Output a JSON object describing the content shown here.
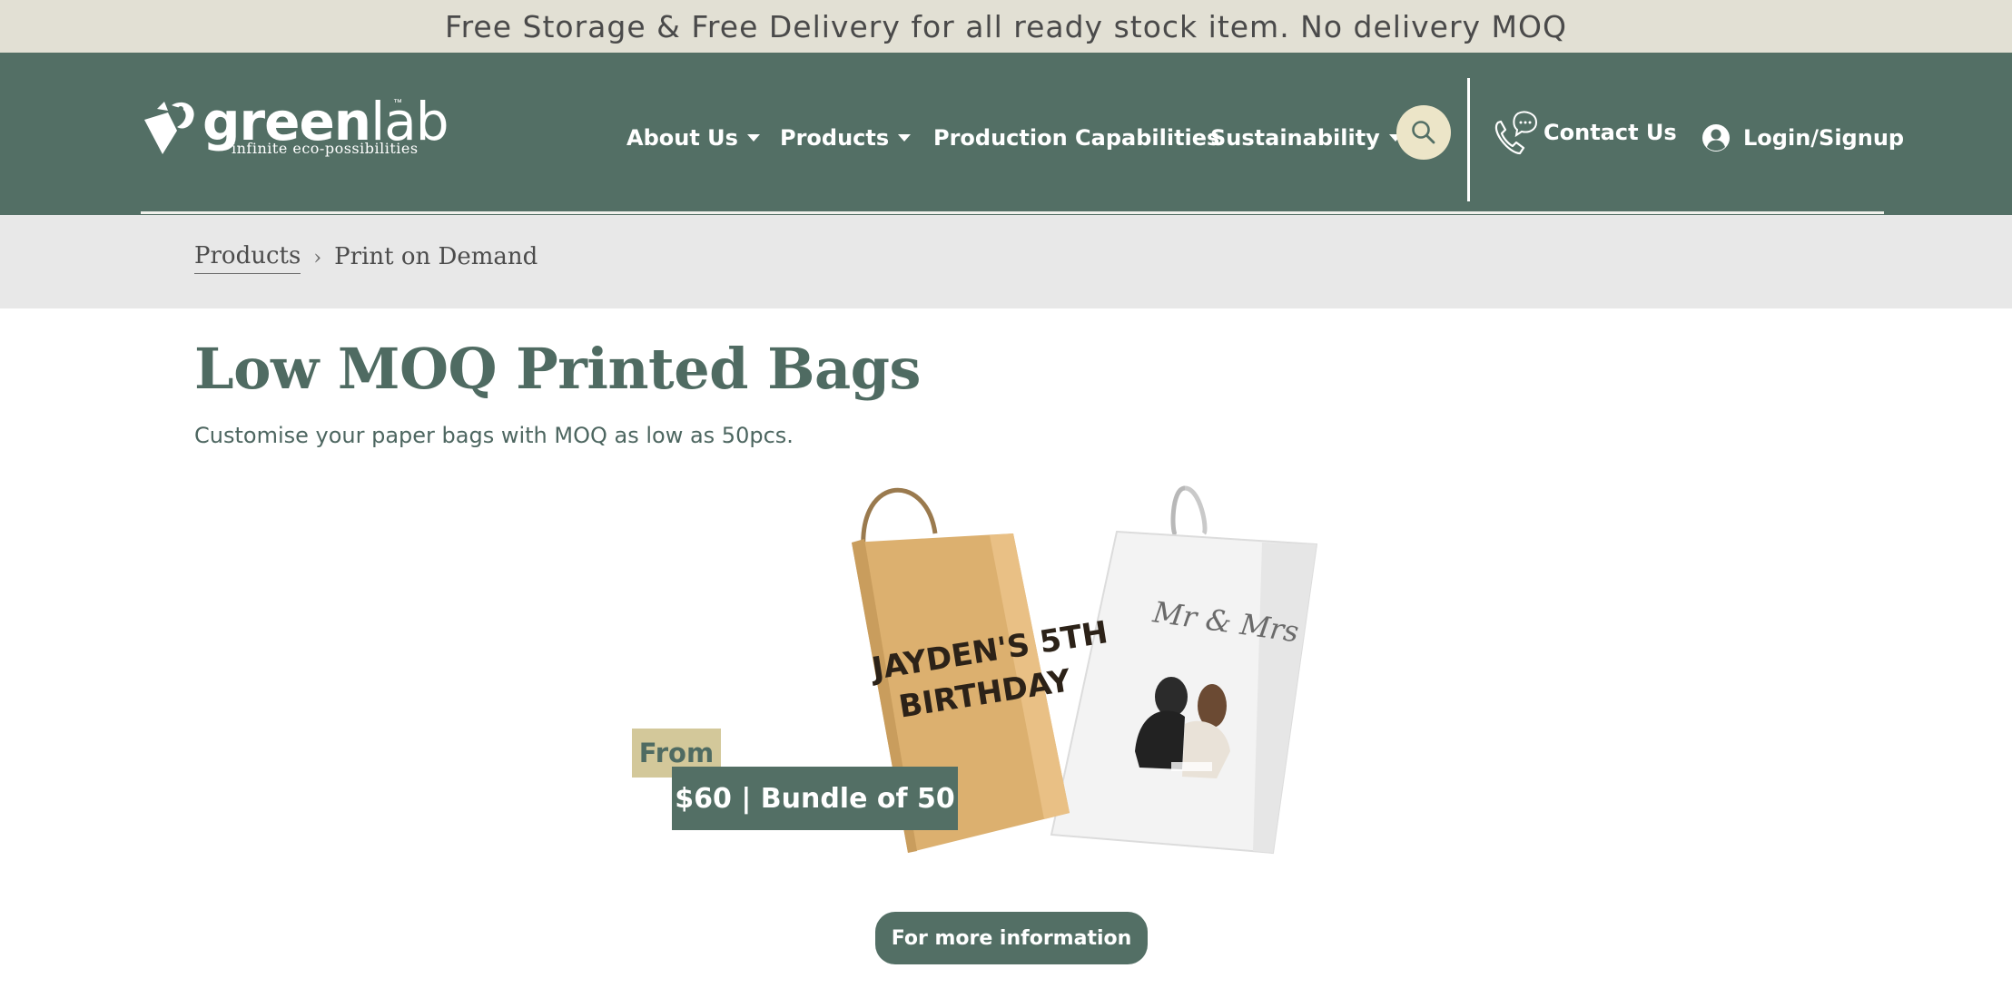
{
  "announcement": {
    "text": "Free Storage & Free Delivery for all ready stock item. No delivery MOQ"
  },
  "logo": {
    "word_bold": "green",
    "word_light": "lab",
    "trademark": "™",
    "tagline": "infinite eco-possibilities"
  },
  "nav": {
    "about": "About Us",
    "products": "Products",
    "production": "Production Capabilities",
    "sustainability": "Sustainability",
    "contact": "Contact Us",
    "login": "Login/Signup"
  },
  "icons": {
    "search": "search-icon",
    "phone": "phone-chat-icon",
    "user": "user-circle-icon",
    "caret": "caret-down-icon"
  },
  "breadcrumb": {
    "parent": "Products",
    "separator": "›",
    "current": "Print on Demand"
  },
  "main": {
    "title": "Low MOQ Printed Bags",
    "subtitle": "Customise your paper bags with MOQ as low as 50pcs.",
    "badge_from": "From",
    "badge_price": "$60 | Bundle of 50",
    "bag1_text_line1": "JAYDEN'S 5TH",
    "bag1_text_line2": "BIRTHDAY",
    "bag2_text": "Mr & Mrs",
    "cta": "For more information"
  },
  "colors": {
    "header": "#536f65",
    "announce_bg": "#e2e0d4",
    "accent": "#ece5c8",
    "badge_from": "#d3c89a",
    "breadcrumb_bg": "#e8e8e8"
  }
}
